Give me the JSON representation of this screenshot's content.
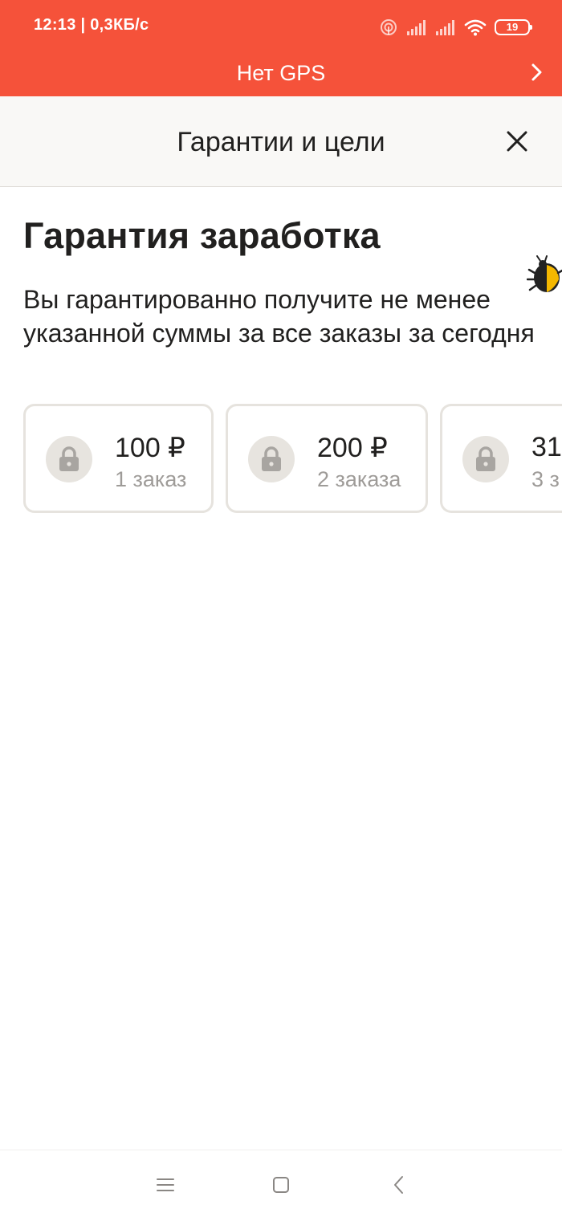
{
  "status_bar": {
    "time": "12:13 | 0,3КБ/с",
    "battery": "19"
  },
  "gps_banner": {
    "text": "Нет GPS"
  },
  "header": {
    "title": "Гарантии и цели"
  },
  "guarantee": {
    "title": "Гарантия заработка",
    "description": "Вы гарантированно получите не менее указанной суммы за все заказы за сегодня",
    "cards": [
      {
        "amount": "100 ₽",
        "orders": "1 заказ"
      },
      {
        "amount": "200 ₽",
        "orders": "2 заказа"
      },
      {
        "amount": "31",
        "orders": "3 з"
      }
    ]
  },
  "colors": {
    "banner": "#f5523a",
    "text": "#21201f",
    "secondary_text": "#9e9b98",
    "card_border": "#e6e3de"
  }
}
